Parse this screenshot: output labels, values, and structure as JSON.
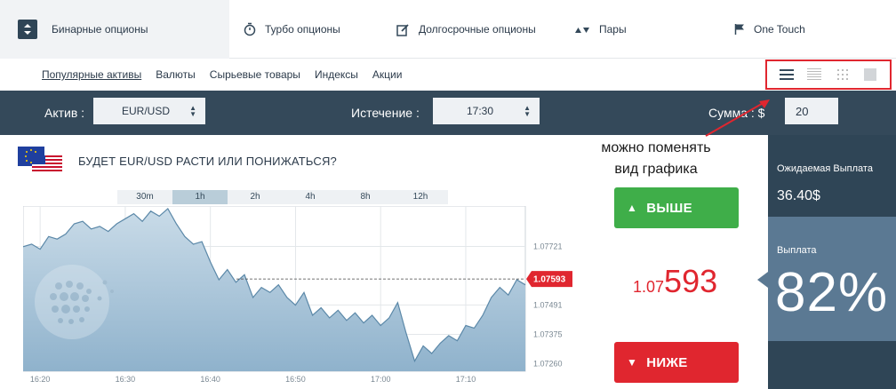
{
  "tabs": [
    {
      "label": "Бинарные опционы",
      "icon": "up-down-arrows-icon"
    },
    {
      "label": "Турбо опционы",
      "icon": "stopwatch-icon"
    },
    {
      "label": "Долгосрочные опционы",
      "icon": "edit-icon"
    },
    {
      "label": "Пары",
      "icon": "triangle-up-down-icon"
    },
    {
      "label": "One Touch",
      "icon": "flag-icon"
    }
  ],
  "subnav": [
    "Популярные активы",
    "Валюты",
    "Сырьевые товары",
    "Индексы",
    "Акции"
  ],
  "bar": {
    "asset_label": "Актив :",
    "asset_value": "EUR/USD",
    "expiry_label": "Истечение :",
    "expiry_value": "17:30",
    "amount_label": "Сумма : $",
    "amount_value": "20"
  },
  "question": "БУДЕТ EUR/USD РАСТИ ИЛИ ПОНИЖАТЬСЯ?",
  "annotation": [
    "можно поменять",
    "вид графика"
  ],
  "timeframes": [
    "30m",
    "1h",
    "2h",
    "4h",
    "8h",
    "12h"
  ],
  "selected_timeframe": "1h",
  "buttons": {
    "up": "ВЫШЕ",
    "down": "НИЖЕ"
  },
  "price": {
    "prefix": "1.07",
    "main": "593"
  },
  "payout": {
    "expected_label": "Ожидаемая Выплата",
    "expected_value": "36.40$",
    "payout_label": "Выплата",
    "payout_value": "82%"
  },
  "colors": {
    "up": "#3fae49",
    "down": "#e0262f",
    "dark": "#34495a",
    "accent_panel": "#5b7993"
  },
  "chart_data": {
    "type": "area",
    "x_ticks": [
      "16:20",
      "16:30",
      "16:40",
      "16:50",
      "17:00",
      "17:10"
    ],
    "y_ticks": [
      1.0726,
      1.07375,
      1.07491,
      1.07721
    ],
    "y_tick_labels": [
      "1.07260",
      "1.07375",
      "1.07491",
      "1.07721"
    ],
    "current_label": "1.07593",
    "current_value": 1.07593,
    "ylim": [
      1.0723,
      1.0788
    ],
    "grid": true,
    "x_minutes": [
      0,
      2,
      4,
      6,
      8,
      10,
      12,
      14,
      16,
      18,
      20,
      22,
      24,
      26,
      28,
      30,
      32,
      34,
      36,
      38,
      40,
      42,
      44,
      46,
      48,
      50,
      52,
      54,
      56,
      58,
      60,
      62,
      64,
      66,
      68,
      70,
      72,
      74,
      76,
      78,
      80,
      82,
      84,
      86,
      88,
      90,
      92,
      94,
      96,
      98,
      100,
      102,
      104,
      106,
      108,
      110,
      112,
      114,
      116,
      118
    ],
    "values": [
      1.0772,
      1.0773,
      1.0771,
      1.0776,
      1.0775,
      1.0777,
      1.0781,
      1.0782,
      1.0779,
      1.078,
      1.0778,
      1.0781,
      1.0783,
      1.0785,
      1.0782,
      1.0786,
      1.0784,
      1.0787,
      1.0781,
      1.0776,
      1.0773,
      1.0774,
      1.0766,
      1.0759,
      1.0763,
      1.0758,
      1.0761,
      1.0752,
      1.0756,
      1.0754,
      1.0757,
      1.0752,
      1.0749,
      1.0754,
      1.0745,
      1.0748,
      1.0744,
      1.0747,
      1.0743,
      1.0746,
      1.0742,
      1.0745,
      1.0741,
      1.0744,
      1.075,
      1.0738,
      1.0727,
      1.0733,
      1.073,
      1.0734,
      1.0737,
      1.0735,
      1.0741,
      1.074,
      1.0745,
      1.0752,
      1.0756,
      1.0753,
      1.0759,
      1.0757
    ]
  }
}
